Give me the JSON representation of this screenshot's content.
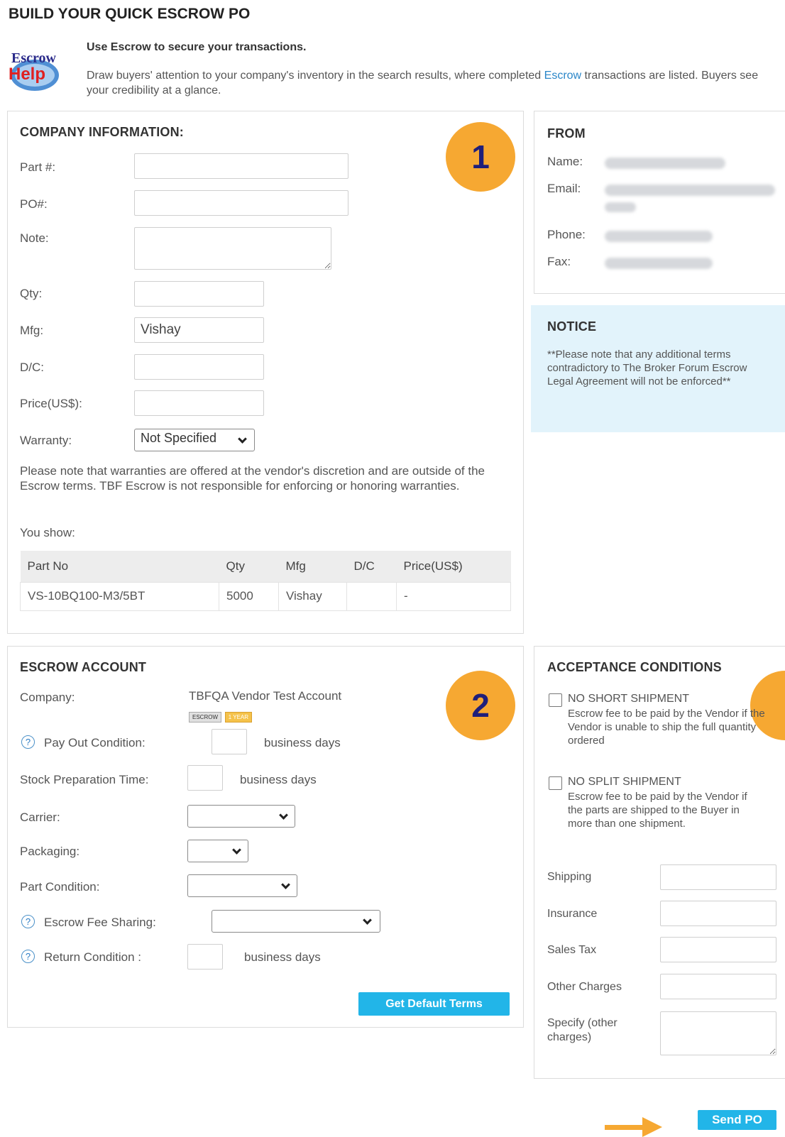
{
  "page": {
    "title": "BUILD YOUR QUICK ESCROW PO",
    "logo_line1": "Escrow",
    "logo_line2": "Help",
    "intro_heading": "Use Escrow to secure your transactions.",
    "intro_text_before": "Draw buyers' attention to your company's inventory in the search results, where completed ",
    "intro_link": "Escrow",
    "intro_text_after": " transactions are listed. Buyers see your credibility at a glance."
  },
  "company": {
    "title": "COMPANY INFORMATION:",
    "badge": "1",
    "fields": {
      "part_label": "Part #:",
      "po_label": "PO#:",
      "note_label": "Note:",
      "qty_label": "Qty:",
      "mfg_label": "Mfg:",
      "mfg_value": "Vishay",
      "dc_label": "D/C:",
      "price_label": "Price(US$):",
      "warranty_label": "Warranty:",
      "warranty_value": "Not Specified"
    },
    "warranty_note": "Please note that warranties are offered at the vendor's discretion and are outside of the Escrow terms. TBF Escrow is not responsible for enforcing or honoring warranties.",
    "you_show": "You show:",
    "table": {
      "headers": [
        "Part No",
        "Qty",
        "Mfg",
        "D/C",
        "Price(US$)"
      ],
      "rows": [
        [
          "VS-10BQ100-M3/5BT",
          "5000",
          "Vishay",
          "",
          "-"
        ]
      ]
    }
  },
  "from": {
    "title": "FROM",
    "name_label": "Name:",
    "email_label": "Email:",
    "phone_label": "Phone:",
    "fax_label": "Fax:"
  },
  "notice": {
    "title": "NOTICE",
    "text": "**Please note that any additional terms contradictory to The Broker Forum Escrow Legal Agreement will not be enforced**"
  },
  "escrow": {
    "title": "ESCROW ACCOUNT",
    "badge": "2",
    "company_label": "Company:",
    "company_value": "TBFQA Vendor Test Account",
    "tag1": "ESCROW",
    "tag2": "1 YEAR",
    "payout_label": "Pay Out Condition:",
    "stock_label": "Stock Preparation Time:",
    "business_days": "business days",
    "carrier_label": "Carrier:",
    "packaging_label": "Packaging:",
    "part_condition_label": "Part Condition:",
    "fee_sharing_label": "Escrow Fee Sharing:",
    "return_label": "Return Condition :",
    "help_glyph": "?",
    "default_terms_button": "Get Default Terms"
  },
  "acceptance": {
    "title": "ACCEPTANCE CONDITIONS",
    "no_short_title": "NO SHORT SHIPMENT",
    "no_short_text": "Escrow fee to be paid by the Vendor if the Vendor is unable to ship the full quantity ordered",
    "no_split_title": "NO SPLIT SHIPMENT",
    "no_split_text": "Escrow fee to be paid by the Vendor if the parts are shipped to the Buyer in more than one shipment.",
    "shipping_label": "Shipping",
    "insurance_label": "Insurance",
    "sales_tax_label": "Sales Tax",
    "other_charges_label": "Other Charges",
    "specify_label": "Specify (other charges)"
  },
  "actions": {
    "send_po_button": "Send PO"
  },
  "colors": {
    "badge_bg": "#f6a832",
    "badge_text": "#1f1f7a",
    "button_bg": "#22b5e8",
    "notice_bg": "#e2f3fb",
    "link": "#2a86c8"
  }
}
